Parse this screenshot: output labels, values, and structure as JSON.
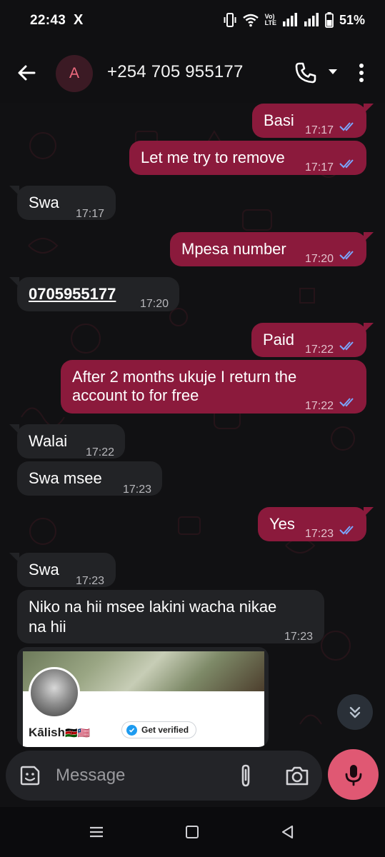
{
  "status_bar": {
    "time": "22:43",
    "x_logo": "X",
    "volte_top": "Vo)",
    "volte_bottom": "LTE",
    "battery_percent": "51%",
    "icons": [
      "vibrate-icon",
      "wifi-icon",
      "volte-icon",
      "signal-icon",
      "signal-icon",
      "battery-icon"
    ]
  },
  "header": {
    "avatar_letter": "A",
    "contact": "+254 705 955177",
    "icons": [
      "back-arrow-icon",
      "phone-icon",
      "caret-down-icon",
      "more-vert-icon"
    ]
  },
  "messages": [
    {
      "dir": "out",
      "text": "Basi",
      "time": "17:17",
      "read": true
    },
    {
      "dir": "out",
      "text": "Let me try to remove",
      "time": "17:17",
      "read": true
    },
    {
      "dir": "in",
      "text": "Swa",
      "time": "17:17"
    },
    {
      "dir": "out",
      "text": "Mpesa number",
      "time": "17:20",
      "read": true
    },
    {
      "dir": "in",
      "text": "0705955177",
      "time": "17:20",
      "is_link": true
    },
    {
      "dir": "out",
      "text": "Paid",
      "time": "17:22",
      "read": true
    },
    {
      "dir": "out",
      "text_line1": "After 2 months ukuje I return the",
      "text_line2": "account to for free",
      "time": "17:22",
      "read": true
    },
    {
      "dir": "in",
      "text": "Walai",
      "time": "17:22"
    },
    {
      "dir": "in",
      "text": "Swa msee",
      "time": "17:23"
    },
    {
      "dir": "out",
      "text": "Yes",
      "time": "17:23",
      "read": true
    },
    {
      "dir": "in",
      "text": "Swa",
      "time": "17:23"
    },
    {
      "dir": "in",
      "text_line1": "Niko na hii msee lakini wacha nikae",
      "text_line2": "na hii",
      "time": "17:23"
    }
  ],
  "preview": {
    "name": "Kālish",
    "flags": "🇰🇪🇱🇷",
    "verified_label": "Get verified"
  },
  "composer": {
    "placeholder": "Message"
  },
  "colors": {
    "outgoing_bubble": "#8b1a3c",
    "incoming_bubble": "#222326",
    "read_ticks": "#7aa7ff",
    "mic_button": "#e05873",
    "link": "#ee6a84"
  }
}
